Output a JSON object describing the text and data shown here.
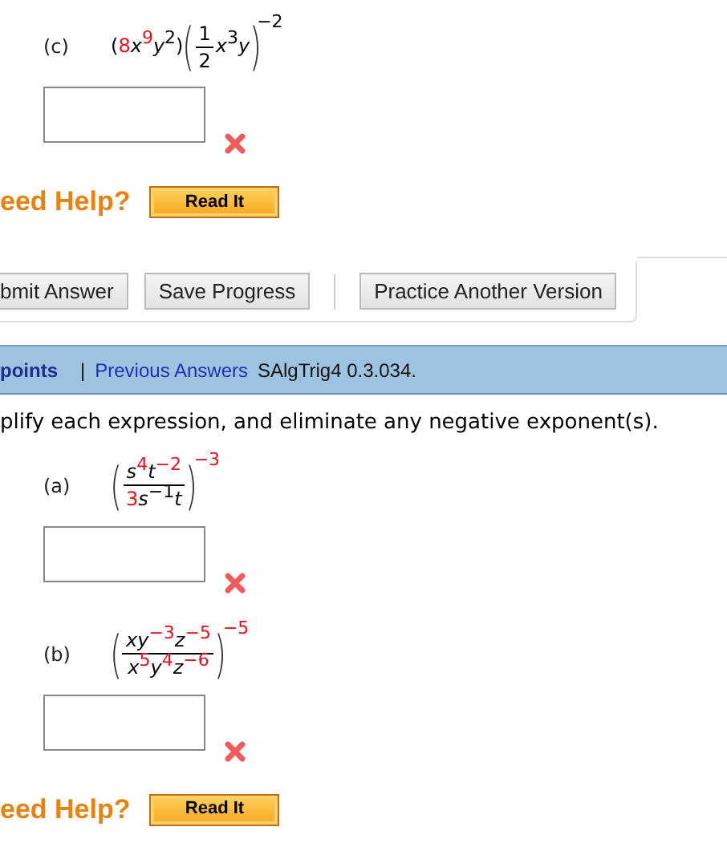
{
  "blocks": [
    {
      "kind": "problem",
      "label": "(c)",
      "correct": false,
      "expression": [
        {
          "kind": "num",
          "text": "(",
          "highlighted": false
        },
        {
          "kind": "num",
          "text": "8",
          "highlighted": true
        },
        {
          "kind": "var",
          "text": "x",
          "highlighted": false
        },
        {
          "kind": "sup",
          "text": "9",
          "highlighted": true
        },
        {
          "kind": "var",
          "text": "y",
          "highlighted": false
        },
        {
          "kind": "sup",
          "text": "2",
          "highlighted": false
        },
        {
          "kind": "num",
          "text": ")",
          "highlighted": false
        },
        {
          "kind": "paren",
          "open": "(",
          "close": ")",
          "children": [
            {
              "kind": "frac",
              "numerator": [
                {
                  "kind": "num",
                  "text": "1",
                  "highlighted": false
                }
              ],
              "denominator": [
                {
                  "kind": "num",
                  "text": "2",
                  "highlighted": false
                }
              ]
            },
            {
              "kind": "var",
              "text": "x",
              "highlighted": false
            },
            {
              "kind": "sup",
              "text": "3",
              "highlighted": false
            },
            {
              "kind": "var",
              "text": "y",
              "highlighted": false
            }
          ]
        },
        {
          "kind": "sup",
          "text": "−2",
          "highlighted": false
        }
      ]
    },
    {
      "kind": "help",
      "label": "eed Help?",
      "button": "Read It"
    },
    {
      "kind": "toolbar",
      "items": [
        {
          "kind": "button",
          "label": "bmit Answer"
        },
        {
          "kind": "button",
          "label": "Save Progress"
        },
        {
          "kind": "separator"
        },
        {
          "kind": "button",
          "label": "Practice Another Version"
        }
      ]
    },
    {
      "kind": "info_bar",
      "points": "points",
      "divider": "|",
      "link": "Previous Answers",
      "source": "SAlgTrig4 0.3.034."
    },
    {
      "kind": "instruction",
      "text": "plify each expression, and eliminate any negative exponent(s)."
    },
    {
      "kind": "problem",
      "label": "(a)",
      "correct": false,
      "expression": [
        {
          "kind": "paren",
          "open": "(",
          "close": ")",
          "children": [
            {
              "kind": "frac",
              "numerator": [
                {
                  "kind": "var",
                  "text": "s",
                  "highlighted": false
                },
                {
                  "kind": "sup",
                  "text": "4",
                  "highlighted": true
                },
                {
                  "kind": "var",
                  "text": "t",
                  "highlighted": false
                },
                {
                  "kind": "sup",
                  "text": "−2",
                  "highlighted": true
                }
              ],
              "denominator": [
                {
                  "kind": "num",
                  "text": "3",
                  "highlighted": true
                },
                {
                  "kind": "var",
                  "text": "s",
                  "highlighted": false
                },
                {
                  "kind": "sup",
                  "text": "−1",
                  "highlighted": false
                },
                {
                  "kind": "var",
                  "text": "t",
                  "highlighted": false
                }
              ]
            }
          ]
        },
        {
          "kind": "sup",
          "text": "−3",
          "highlighted": true
        }
      ]
    },
    {
      "kind": "problem",
      "label": "(b)",
      "correct": false,
      "expression": [
        {
          "kind": "paren",
          "open": "(",
          "close": ")",
          "children": [
            {
              "kind": "frac",
              "numerator": [
                {
                  "kind": "var",
                  "text": "x",
                  "highlighted": false
                },
                {
                  "kind": "var",
                  "text": "y",
                  "highlighted": false
                },
                {
                  "kind": "sup",
                  "text": "−3",
                  "highlighted": true
                },
                {
                  "kind": "var",
                  "text": "z",
                  "highlighted": false
                },
                {
                  "kind": "sup",
                  "text": "−5",
                  "highlighted": true
                }
              ],
              "denominator": [
                {
                  "kind": "var",
                  "text": "x",
                  "highlighted": false
                },
                {
                  "kind": "sup",
                  "text": "5",
                  "highlighted": true
                },
                {
                  "kind": "var",
                  "text": "y",
                  "highlighted": false
                },
                {
                  "kind": "sup",
                  "text": "4",
                  "highlighted": true
                },
                {
                  "kind": "var",
                  "text": "z",
                  "highlighted": false
                },
                {
                  "kind": "sup",
                  "text": "−6",
                  "highlighted": true
                }
              ]
            }
          ]
        },
        {
          "kind": "sup",
          "text": "−5",
          "highlighted": true
        }
      ]
    },
    {
      "kind": "help",
      "label": "eed Help?",
      "button": "Read It"
    }
  ]
}
